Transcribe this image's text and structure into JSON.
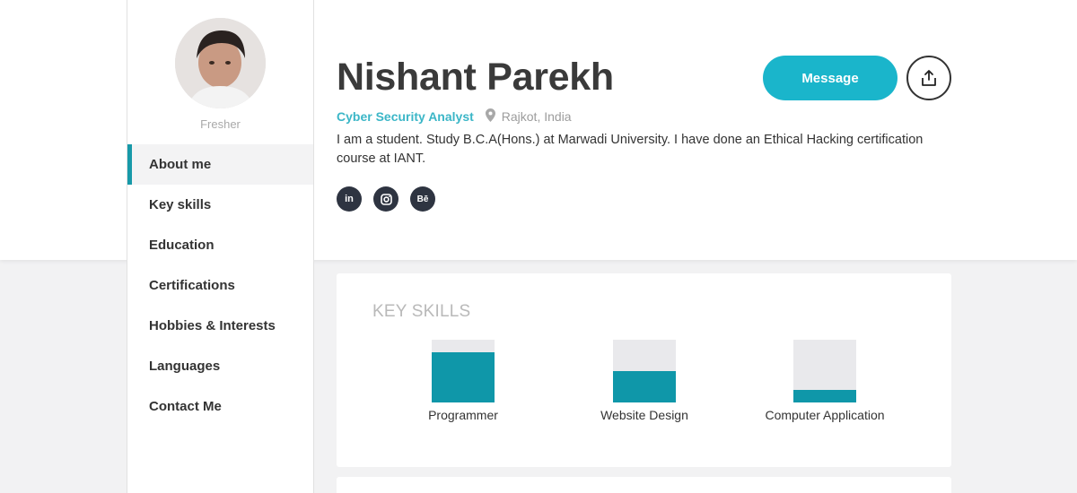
{
  "profile": {
    "name": "Nishant Parekh",
    "status": "Fresher",
    "role": "Cyber Security Analyst",
    "location": "Rajkot, India",
    "bio": "I am a student. Study B.C.A(Hons.) at Marwadi University. I have done an Ethical Hacking certification course at IANT.",
    "social": [
      {
        "icon": "linkedin-icon",
        "glyph": "in"
      },
      {
        "icon": "instagram-icon",
        "glyph": ""
      },
      {
        "icon": "behance-icon",
        "glyph": "Bē"
      }
    ]
  },
  "actions": {
    "message_label": "Message",
    "share_icon": "share-icon"
  },
  "nav": {
    "items": [
      {
        "label": "About me",
        "active": true
      },
      {
        "label": "Key skills",
        "active": false
      },
      {
        "label": "Education",
        "active": false
      },
      {
        "label": "Certifications",
        "active": false
      },
      {
        "label": "Hobbies & Interests",
        "active": false
      },
      {
        "label": "Languages",
        "active": false
      },
      {
        "label": "Contact Me",
        "active": false
      }
    ]
  },
  "skills": {
    "title": "KEY SKILLS",
    "items": [
      {
        "label": "Programmer",
        "level": 0.8
      },
      {
        "label": "Website Design",
        "level": 0.5
      },
      {
        "label": "Computer Application",
        "level": 0.2
      }
    ]
  },
  "colors": {
    "accent": "#1ab5cb",
    "skill_fill": "#0f97a9",
    "role": "#3bb6c7"
  }
}
